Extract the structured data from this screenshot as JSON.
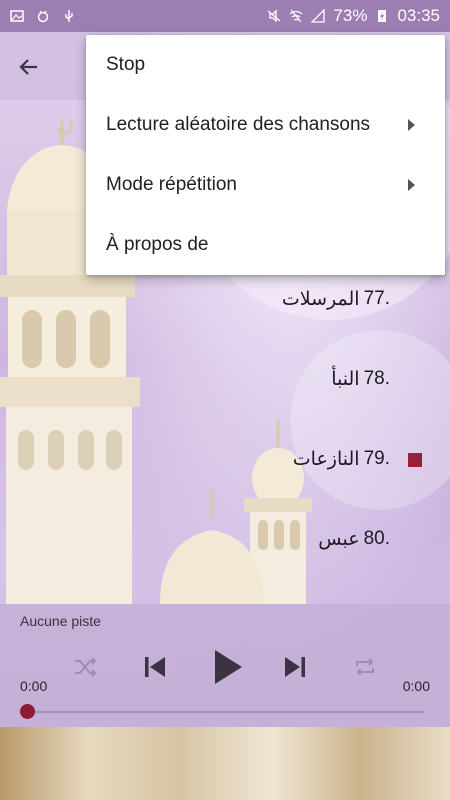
{
  "status_bar": {
    "battery": "73%",
    "time": "03:35",
    "icons": [
      "image-icon",
      "android-debug-icon",
      "usb-icon",
      "mute-icon",
      "wifi-off-icon",
      "signal-icon",
      "battery-charging-icon"
    ]
  },
  "toolbar": {
    "back_icon": "arrow-left-icon"
  },
  "menu": {
    "items": [
      {
        "label": "Stop",
        "has_submenu": false
      },
      {
        "label": "Lecture aléatoire des chansons",
        "has_submenu": true
      },
      {
        "label": "Mode répétition",
        "has_submenu": true
      },
      {
        "label": "À propos de",
        "has_submenu": false
      }
    ]
  },
  "tracks": [
    {
      "number": "77.",
      "name": "المرسلات",
      "playing": false
    },
    {
      "number": "78.",
      "name": "النبأ",
      "playing": false
    },
    {
      "number": "79.",
      "name": "النازعات",
      "playing": true
    },
    {
      "number": "80.",
      "name": "عبس",
      "playing": false
    }
  ],
  "player": {
    "track_title": "Aucune piste",
    "elapsed": "0:00",
    "duration": "0:00",
    "progress": 0,
    "controls": [
      "shuffle-icon",
      "skip-previous-icon",
      "play-icon",
      "skip-next-icon",
      "repeat-icon"
    ]
  },
  "colors": {
    "accent": "#9a1f3b",
    "status_bar": "#9b7fb3"
  }
}
